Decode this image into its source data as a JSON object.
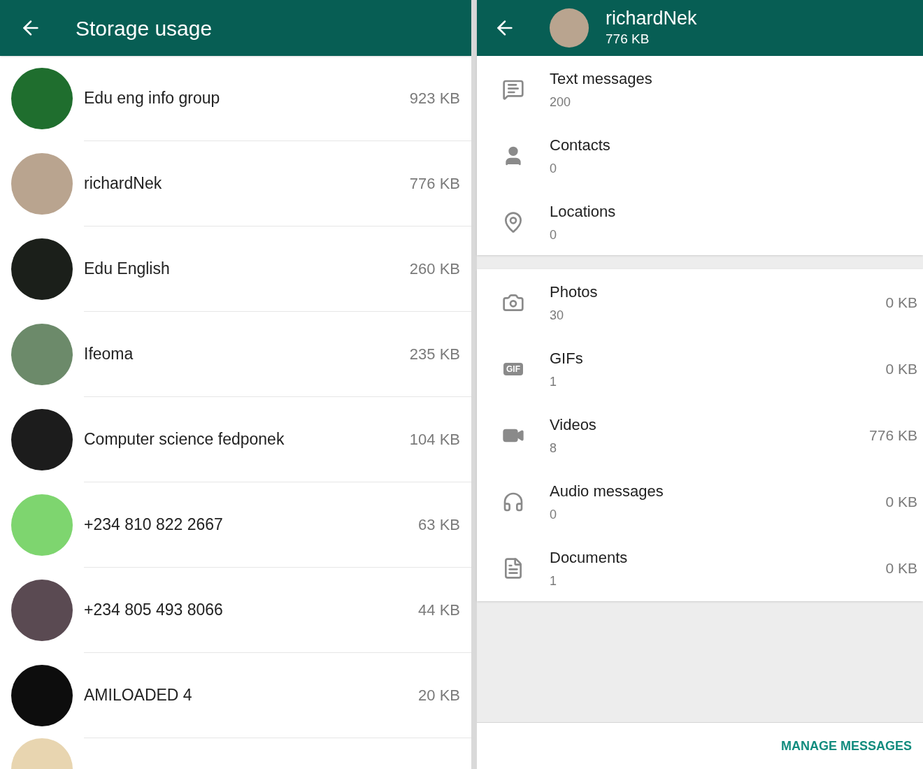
{
  "left": {
    "title": "Storage usage",
    "chats": [
      {
        "name": "Edu eng info group",
        "size": "923 KB",
        "color": "#1f6e2e"
      },
      {
        "name": "richardNek",
        "size": "776 KB",
        "color": "#b9a48f"
      },
      {
        "name": "Edu English",
        "size": "260 KB",
        "color": "#1b1f1a"
      },
      {
        "name": "Ifeoma",
        "size": "235 KB",
        "color": "#6c8a6a"
      },
      {
        "name": "Computer science fedponek",
        "size": "104 KB",
        "color": "#1c1c1c"
      },
      {
        "name": "+234 810 822 2667",
        "size": "63 KB",
        "color": "#7ed56f"
      },
      {
        "name": "+234 805 493 8066",
        "size": "44 KB",
        "color": "#5a4a52"
      },
      {
        "name": "AMILOADED 4",
        "size": "20 KB",
        "color": "#0d0d0d"
      }
    ]
  },
  "right": {
    "name": "richardNek",
    "size": "776 KB",
    "sections": [
      [
        {
          "kind": "text",
          "label": "Text messages",
          "count": "200"
        },
        {
          "kind": "contact",
          "label": "Contacts",
          "count": "0"
        },
        {
          "kind": "location",
          "label": "Locations",
          "count": "0"
        }
      ],
      [
        {
          "kind": "photo",
          "label": "Photos",
          "count": "30",
          "size": "0 KB"
        },
        {
          "kind": "gif",
          "label": "GIFs",
          "count": "1",
          "size": "0 KB",
          "icon_text": "GIF"
        },
        {
          "kind": "video",
          "label": "Videos",
          "count": "8",
          "size": "776 KB"
        },
        {
          "kind": "audio",
          "label": "Audio messages",
          "count": "0",
          "size": "0 KB"
        },
        {
          "kind": "document",
          "label": "Documents",
          "count": "1",
          "size": "0 KB"
        }
      ]
    ],
    "action": "MANAGE MESSAGES"
  }
}
